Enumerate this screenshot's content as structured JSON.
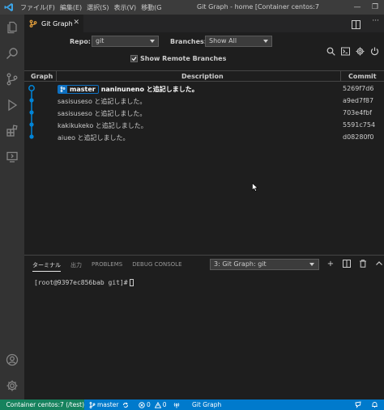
{
  "titlebar": {
    "menu": [
      "ファイル(F)",
      "編集(E)",
      "選択(S)",
      "表示(V)",
      "移動(G"
    ],
    "window_title": "Git Graph - home [Container centos:7 (/tes..."
  },
  "editor_tab": {
    "label": "Git Graph"
  },
  "controls": {
    "repo_label": "Repo:",
    "repo_value": "git",
    "branches_label": "Branches:",
    "branches_value": "Show All",
    "show_remote_label": "Show Remote Branches",
    "show_remote_checked": true
  },
  "table": {
    "headers": {
      "graph": "Graph",
      "description": "Description",
      "commit": "Commit"
    },
    "rows": [
      {
        "branch": "master",
        "description": "naninuneno と追記しました。",
        "commit": "5269f7d6",
        "head": true
      },
      {
        "branch": "",
        "description": "sasisuseso と追記しました。",
        "commit": "a9ed7f87",
        "head": false
      },
      {
        "branch": "",
        "description": "sasisuseso と追記しました。",
        "commit": "703e4fbf",
        "head": false
      },
      {
        "branch": "",
        "description": "kakikukeko と追記しました。",
        "commit": "5591c754",
        "head": false
      },
      {
        "branch": "",
        "description": "aiueo と追記しました。",
        "commit": "d08280f0",
        "head": false
      }
    ],
    "graph_color": "#0085d9"
  },
  "panel": {
    "tabs": [
      "ターミナル",
      "出力",
      "PROBLEMS",
      "DEBUG CONSOLE"
    ],
    "active_tab": "ターミナル",
    "terminal_select": "3: Git Graph: git",
    "prompt": "[root@9397ec856bab git]#"
  },
  "statusbar": {
    "remote": "Container centos:7 (/test)",
    "branch": "master",
    "errors": "0",
    "warnings": "0",
    "git_graph": "Git Graph"
  },
  "colors": {
    "accent": "#007acc",
    "remote_bg": "#16825d",
    "branch": "#0e70c0"
  },
  "icons": {
    "activity": [
      "explorer-icon",
      "search-icon",
      "source-control-icon",
      "run-debug-icon",
      "extensions-icon",
      "remote-explorer-icon",
      "account-icon",
      "settings-gear-icon"
    ]
  }
}
